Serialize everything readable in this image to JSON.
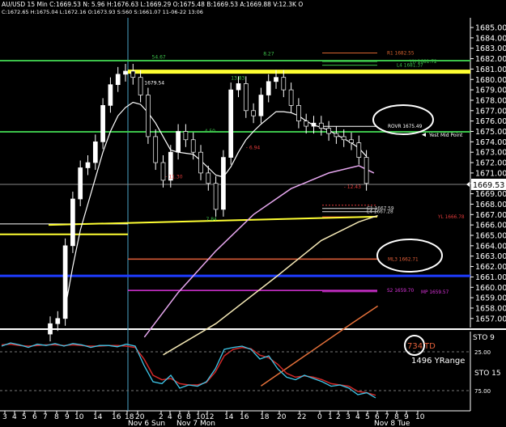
{
  "window": {
    "info_line_1": "AU/USD 15 Min  C:1669.53  N: 5.96  H:1676.63  L:1669.29  O:1675.48  B:1669.53  A:1669.88  V:12.3K  O",
    "info_line_2": "C:1672.65  H:1675.04  L:1672.16  O:1673.93  S:560  S:1661.07  11-06-22  13:06"
  },
  "price_axis": {
    "ticks": [
      "1685.00",
      "1684.00",
      "1683.00",
      "1682.00",
      "1681.00",
      "1680.00",
      "1679.00",
      "1678.00",
      "1677.00",
      "1676.00",
      "1675.00",
      "1674.00",
      "1673.00",
      "1672.00",
      "1671.00",
      "1670.00",
      "1669.00",
      "1668.00",
      "1667.00",
      "1666.00",
      "1665.00",
      "1664.00",
      "1663.00",
      "1662.00",
      "1661.00",
      "1660.00",
      "1659.00",
      "1658.00",
      "1657.00"
    ],
    "current_price": "1669.53"
  },
  "levels": [
    {
      "label": "R1  1682.55",
      "price": 1682.55,
      "color": "#d8652f"
    },
    {
      "label": "YH  1681.72",
      "price": 1681.72,
      "color": "#3cc24a"
    },
    {
      "label": "L4  1681.37",
      "price": 1681.37,
      "color": "#3cc24a"
    },
    {
      "label": "1680.5",
      "price": 1680.75,
      "color": "#ffff33"
    },
    {
      "label": "ROVR  1675.49",
      "price": 1675.49,
      "color": "#ffffff"
    },
    {
      "label": "Yest Mid Point",
      "price": 1674.6,
      "color": "#ffffff"
    },
    {
      "label": "C1  1667.59",
      "price": 1667.59,
      "color": "#dddddd"
    },
    {
      "label": "L4  1667.28",
      "price": 1667.28,
      "color": "#dddddd"
    },
    {
      "label": "YL  1666.78",
      "price": 1666.78,
      "color": "#e23a3a"
    },
    {
      "label": "ML3  1662.71",
      "price": 1662.71,
      "color": "#e4603a"
    },
    {
      "label": "S2  1659.70",
      "price": 1659.7,
      "color": "#dd33dd"
    },
    {
      "label": "MP  1659.57",
      "price": 1659.57,
      "color": "#dd33dd"
    }
  ],
  "annotations": [
    {
      "text": "54.67",
      "time": 13.5,
      "price": 1682.0
    },
    {
      "text": "1679.54",
      "time": 12.5,
      "price": 1679.5
    },
    {
      "text": "13.83",
      "time": 24.0,
      "price": 1680.0
    },
    {
      "text": "8.27",
      "time": 28.3,
      "price": 1682.3
    },
    {
      "text": "4.50",
      "time": 20.5,
      "price": 1674.9
    },
    {
      "text": "- 6.94",
      "time": 26.0,
      "price": 1673.3
    },
    {
      "text": "- 11.30",
      "time": 15.3,
      "price": 1670.5
    },
    {
      "text": "7.84",
      "time": 20.7,
      "price": 1666.4
    },
    {
      "text": "- 12.43",
      "time": 39.0,
      "price": 1669.5
    }
  ],
  "oscillator": {
    "sto_label_top": "STO  9",
    "sto_label_bottom": "STO  15",
    "level_25": "25.00",
    "level_75": "75.00",
    "td_value": "734",
    "td_suffix": "TD",
    "yrange_text": "1496 YRange"
  },
  "time_axis": {
    "ticks": [
      "3",
      "4",
      "5",
      "6",
      "7",
      "8",
      "9",
      "10",
      "14",
      "16",
      "18",
      "20",
      "2",
      "4",
      "6",
      "8",
      "10",
      "12",
      "14",
      "16",
      "18",
      "20",
      "22",
      "0",
      "1",
      "2",
      "3",
      "4",
      "5",
      "6",
      "7",
      "8",
      "9",
      "10"
    ],
    "day_labels": [
      "Nov 6 Sun",
      "Nov 7 Mon",
      "Nov 8 Tue"
    ]
  },
  "chart_data": {
    "type": "candlestick",
    "y_range": [
      1656,
      1686
    ],
    "price_series_close": [
      1656.5,
      1657.0,
      1664.0,
      1668.5,
      1671.5,
      1672.0,
      1674.0,
      1677.5,
      1679.5,
      1680.5,
      1680.8,
      1680.2,
      1678.5,
      1674.5,
      1672.0,
      1670.3,
      1673.0,
      1675.0,
      1674.2,
      1673.0,
      1671.0,
      1670.0,
      1667.5,
      1672.5,
      1679.0,
      1679.6,
      1677.0,
      1676.5,
      1678.5,
      1679.8,
      1680.2,
      1679.0,
      1677.5,
      1676.0,
      1675.5,
      1675.8,
      1675.3,
      1674.8,
      1674.5,
      1674.2,
      1673.9,
      1672.5,
      1670.0
    ],
    "moving_average_white": [
      1651.0,
      1654.0,
      1658.0,
      1662.0,
      1665.5,
      1668.0,
      1670.5,
      1673.0,
      1675.0,
      1676.5,
      1677.3,
      1677.8,
      1677.6,
      1676.8,
      1675.8,
      1674.5,
      1673.2,
      1673.0,
      1672.9,
      1672.8,
      1672.2,
      1671.5,
      1670.8,
      1670.6,
      1671.6,
      1673.0,
      1674.2,
      1675.0,
      1675.7,
      1676.3,
      1676.9,
      1676.9,
      1676.8,
      1676.5,
      1676.0,
      1675.6,
      1675.4,
      1675.1,
      1674.7,
      1674.3,
      1673.9,
      1673.4,
      1672.6
    ],
    "moving_average_magenta": {
      "start": [
        12.5,
        1655.2
      ],
      "points": [
        [
          12.5,
          1655.2
        ],
        [
          17,
          1659.5
        ],
        [
          22,
          1663.5
        ],
        [
          27,
          1667.0
        ],
        [
          32,
          1669.5
        ],
        [
          37,
          1671.0
        ],
        [
          41,
          1671.7
        ],
        [
          43,
          1671.0
        ]
      ]
    },
    "moving_average_beige": {
      "points": [
        [
          15,
          1653.5
        ],
        [
          22,
          1656.5
        ],
        [
          30,
          1661.0
        ],
        [
          36,
          1664.5
        ],
        [
          41,
          1666.3
        ],
        [
          43.5,
          1666.9
        ]
      ]
    },
    "moving_average_orange": {
      "points": [
        [
          28,
          1650.5
        ],
        [
          34,
          1653.5
        ],
        [
          40,
          1656.5
        ],
        [
          43.5,
          1658.2
        ]
      ]
    },
    "blue_line_price": 1661.1,
    "yellow_bottom_line_price": 1666.2,
    "stochastic_cyan": [
      10,
      5,
      8,
      12,
      7,
      9,
      6,
      10,
      6,
      8,
      12,
      9,
      9,
      11,
      7,
      10,
      40,
      65,
      68,
      55,
      75,
      70,
      72,
      65,
      45,
      15,
      12,
      10,
      15,
      30,
      25,
      45,
      58,
      62,
      55,
      60,
      65,
      72,
      70,
      75,
      85,
      82,
      90
    ],
    "stochastic_red": [
      8,
      7,
      9,
      10,
      9,
      8,
      8,
      9,
      8,
      9,
      10,
      10,
      9,
      9,
      10,
      12,
      30,
      55,
      62,
      60,
      68,
      70,
      70,
      66,
      50,
      25,
      15,
      12,
      14,
      24,
      28,
      38,
      52,
      58,
      56,
      58,
      62,
      68,
      70,
      72,
      80,
      82,
      86
    ]
  }
}
